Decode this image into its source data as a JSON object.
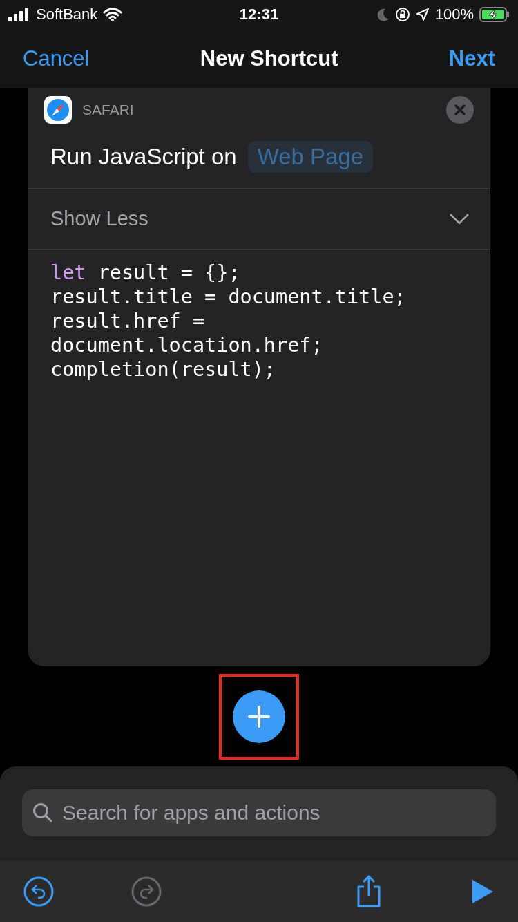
{
  "status_bar": {
    "carrier": "SoftBank",
    "time": "12:31",
    "battery": "100%",
    "charging": true
  },
  "nav": {
    "cancel": "Cancel",
    "title": "New Shortcut",
    "next": "Next"
  },
  "action": {
    "app": "SAFARI",
    "title": "Run JavaScript on",
    "parameter": "Web Page",
    "toggle": "Show Less",
    "expanded": true,
    "code": [
      {
        "keyword": "let",
        "text": " result = {};"
      },
      {
        "text": "result.title = document.title;"
      },
      {
        "text": "result.href ="
      },
      {
        "text": "document.location.href;"
      },
      {
        "text": "completion(result);"
      }
    ]
  },
  "add_button": {
    "highlighted": true
  },
  "search": {
    "placeholder": "Search for apps and actions"
  },
  "toolbar": {
    "undo_disabled": false,
    "redo_disabled": true
  }
}
